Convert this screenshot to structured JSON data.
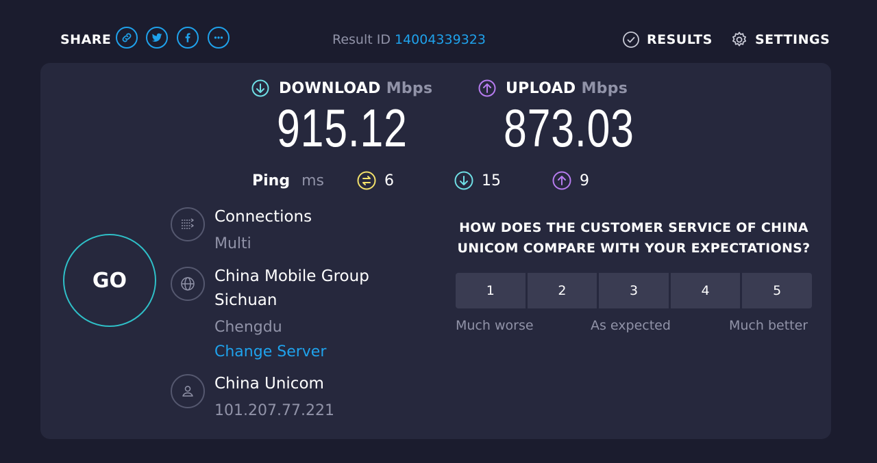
{
  "share": {
    "label": "SHARE",
    "buttons": [
      {
        "icon": "link-icon"
      },
      {
        "icon": "twitter-icon"
      },
      {
        "icon": "facebook-icon"
      },
      {
        "icon": "more-icon"
      }
    ]
  },
  "result": {
    "label": "Result ID",
    "id": "14004339323"
  },
  "nav": {
    "results": "RESULTS",
    "settings": "SETTINGS"
  },
  "download": {
    "label": "DOWNLOAD",
    "unit": "Mbps",
    "value": "915.12"
  },
  "upload": {
    "label": "UPLOAD",
    "unit": "Mbps",
    "value": "873.03"
  },
  "ping": {
    "label": "Ping",
    "unit": "ms",
    "idle": "6",
    "download": "15",
    "upload": "9"
  },
  "go": {
    "label": "GO"
  },
  "connections": {
    "title": "Connections",
    "value": "Multi"
  },
  "server": {
    "name_line1": "China Mobile Group",
    "name_line2": "Sichuan",
    "city": "Chengdu",
    "change": "Change Server"
  },
  "isp": {
    "name": "China Unicom",
    "ip": "101.207.77.221"
  },
  "survey": {
    "question_line1": "HOW DOES THE CUSTOMER SERVICE OF CHINA",
    "question_line2": "UNICOM COMPARE WITH YOUR EXPECTATIONS?",
    "options": [
      "1",
      "2",
      "3",
      "4",
      "5"
    ],
    "low": "Much worse",
    "mid": "As expected",
    "high": "Much better"
  },
  "colors": {
    "background": "#1b1c2e",
    "card": "#26283d",
    "accent_blue": "#1fa2ec",
    "download_cyan": "#6fe0e6",
    "upload_purple": "#b77cf0",
    "ping_yellow": "#f4e36b",
    "muted": "#9193a8"
  }
}
